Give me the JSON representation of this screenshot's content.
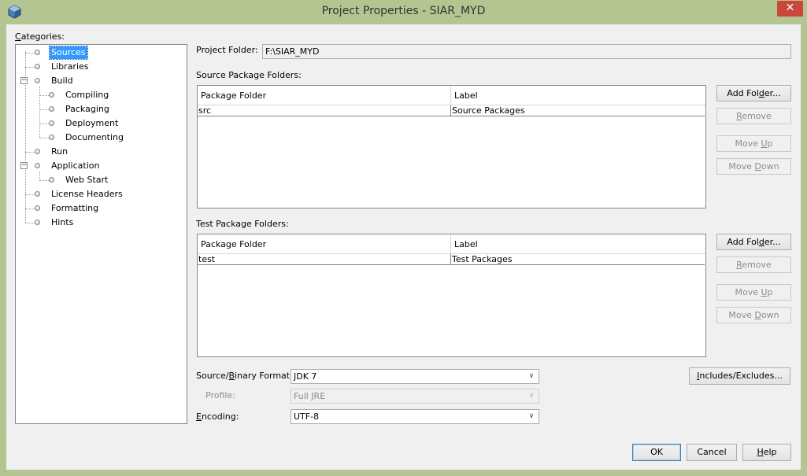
{
  "window": {
    "title": "Project Properties - SIAR_MYD",
    "close_glyph": "✕"
  },
  "categories": {
    "label": "Categories:",
    "items": [
      {
        "label": "Sources",
        "selected": true
      },
      {
        "label": "Libraries"
      },
      {
        "label": "Build",
        "expanded": true
      },
      {
        "label": "Compiling"
      },
      {
        "label": "Packaging"
      },
      {
        "label": "Deployment"
      },
      {
        "label": "Documenting"
      },
      {
        "label": "Run"
      },
      {
        "label": "Application",
        "expanded": true
      },
      {
        "label": "Web Start"
      },
      {
        "label": "License Headers"
      },
      {
        "label": "Formatting"
      },
      {
        "label": "Hints"
      }
    ]
  },
  "project_folder": {
    "label": "Project Folder:",
    "value": "F:\\SIAR_MYD"
  },
  "source_folders": {
    "label": "Source Package Folders:",
    "columns": [
      "Package Folder",
      "Label"
    ],
    "rows": [
      {
        "folder": "src",
        "label": "Source Packages"
      }
    ],
    "buttons": {
      "add": "Add Folder...",
      "remove": "Remove",
      "up": "Move Up",
      "down": "Move Down"
    }
  },
  "test_folders": {
    "label": "Test Package Folders:",
    "columns": [
      "Package Folder",
      "Label"
    ],
    "rows": [
      {
        "folder": "test",
        "label": "Test Packages"
      }
    ],
    "buttons": {
      "add": "Add Folder...",
      "remove": "Remove",
      "up": "Move Up",
      "down": "Move Down"
    }
  },
  "format": {
    "label": "Source/Binary Format:",
    "value": "JDK 7"
  },
  "profile": {
    "label": "Profile:",
    "value": "Full JRE"
  },
  "encoding": {
    "label": "Encoding:",
    "value": "UTF-8"
  },
  "includes_button": "Includes/Excludes...",
  "footer": {
    "ok": "OK",
    "cancel": "Cancel",
    "help": "Help"
  },
  "colors": {
    "titlebar": "#b4c591",
    "close": "#c9483a",
    "selection": "#3399ff"
  }
}
